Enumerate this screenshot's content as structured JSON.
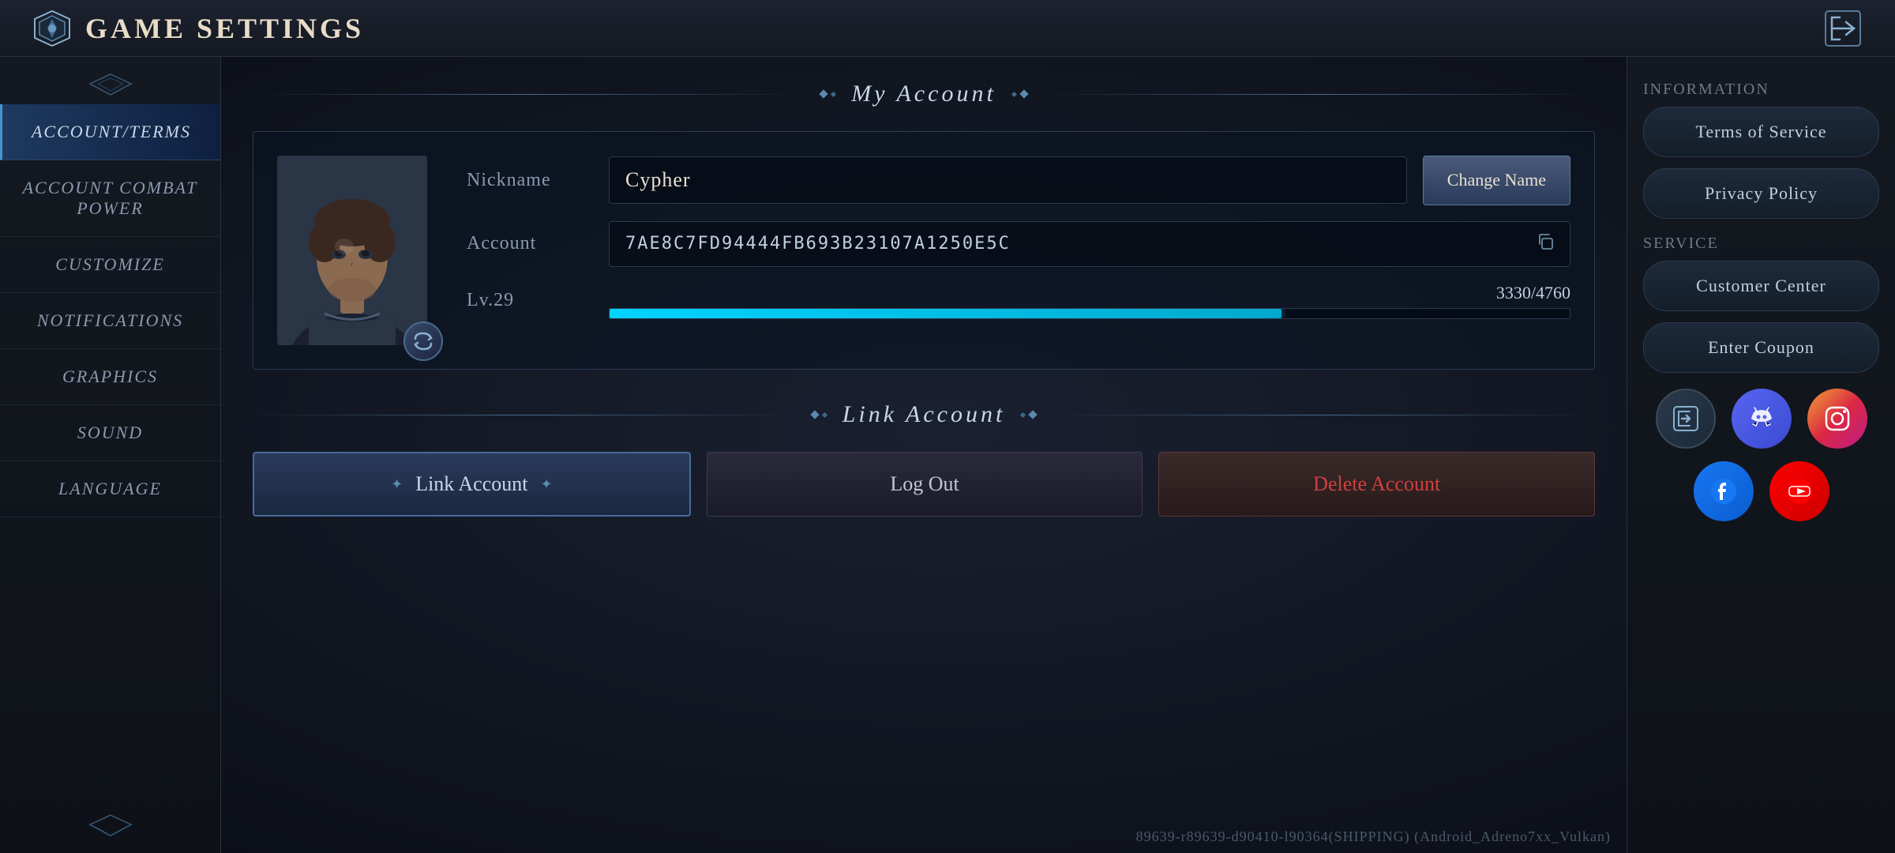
{
  "header": {
    "logo_alt": "Game Logo",
    "title": "Game Settings",
    "exit_label": "Exit"
  },
  "sidebar": {
    "ornament_top": "◇",
    "ornament_bottom": "◇",
    "items": [
      {
        "id": "account-terms",
        "label": "Account/Terms",
        "active": true
      },
      {
        "id": "account-combat-power",
        "label": "Account Combat Power",
        "active": false
      },
      {
        "id": "customize",
        "label": "Customize",
        "active": false
      },
      {
        "id": "notifications",
        "label": "Notifications",
        "active": false
      },
      {
        "id": "graphics",
        "label": "Graphics",
        "active": false
      },
      {
        "id": "sound",
        "label": "Sound",
        "active": false
      },
      {
        "id": "language",
        "label": "Language",
        "active": false
      }
    ]
  },
  "my_account": {
    "section_title": "My Account",
    "nickname_label": "Nickname",
    "nickname_value": "Cypher",
    "change_name_btn": "Change\nName",
    "account_label": "Account",
    "account_id": "7AE8C7FD94444FB693B23107A1250E5C",
    "level_label": "Lv.29",
    "level_xp_current": 3330,
    "level_xp_max": 4760,
    "level_xp_display": "3330/4760",
    "level_progress_pct": 70
  },
  "link_account": {
    "section_title": "Link Account",
    "btn_link_label": "Link Account",
    "btn_logout_label": "Log Out",
    "btn_delete_label": "Delete Account"
  },
  "right_panel": {
    "information_label": "Information",
    "terms_btn": "Terms of Service",
    "privacy_btn": "Privacy Policy",
    "service_label": "Service",
    "customer_btn": "Customer Center",
    "coupon_btn": "Enter Coupon"
  },
  "social": {
    "share_icon": "↗",
    "discord_icon": "D",
    "instagram_icon": "📷",
    "facebook_icon": "f",
    "youtube_icon": "▶"
  },
  "footer": {
    "build_info": "89639-r89639-d90410-l90364(SHIPPING)   (Android_Adreno7xx_Vulkan)"
  }
}
